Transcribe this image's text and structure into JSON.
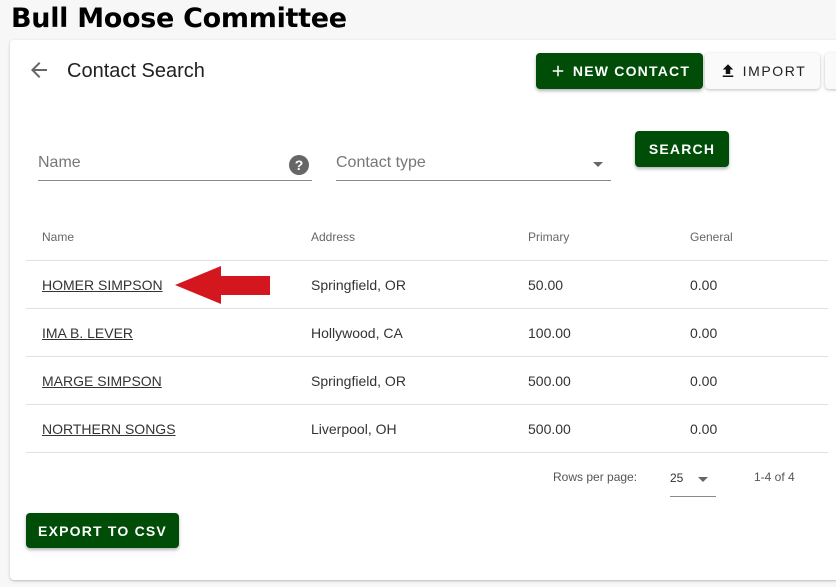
{
  "app": {
    "title": "Bull Moose Committee"
  },
  "header": {
    "back_icon": "arrow-left-icon",
    "title": "Contact Search",
    "new_contact_label": "NEW CONTACT",
    "new_contact_icon": "plus-icon",
    "import_label": "IMPORT",
    "import_icon": "upload-icon"
  },
  "search": {
    "name_placeholder": "Name",
    "name_value": "",
    "help_icon": "?",
    "contact_type_placeholder": "Contact type",
    "contact_type_value": "",
    "search_label": "SEARCH"
  },
  "table": {
    "columns": [
      "Name",
      "Address",
      "Primary",
      "General"
    ],
    "rows": [
      {
        "name": "HOMER SIMPSON",
        "address": "Springfield, OR",
        "primary": "50.00",
        "general": "0.00"
      },
      {
        "name": "IMA B. LEVER",
        "address": "Hollywood, CA",
        "primary": "100.00",
        "general": "0.00"
      },
      {
        "name": "MARGE SIMPSON",
        "address": "Springfield, OR",
        "primary": "500.00",
        "general": "0.00"
      },
      {
        "name": "NORTHERN SONGS",
        "address": "Liverpool, OH",
        "primary": "500.00",
        "general": "0.00"
      }
    ]
  },
  "annotation": {
    "arrow_color": "#d4161e",
    "points_to": "HOMER SIMPSON"
  },
  "pagination": {
    "rows_per_page_label": "Rows per page:",
    "rows_per_page_value": "25",
    "range": "1-4 of 4"
  },
  "footer": {
    "export_label": "EXPORT TO CSV"
  },
  "colors": {
    "brand_green": "#004d08",
    "link_green": "#1b6e1b"
  }
}
